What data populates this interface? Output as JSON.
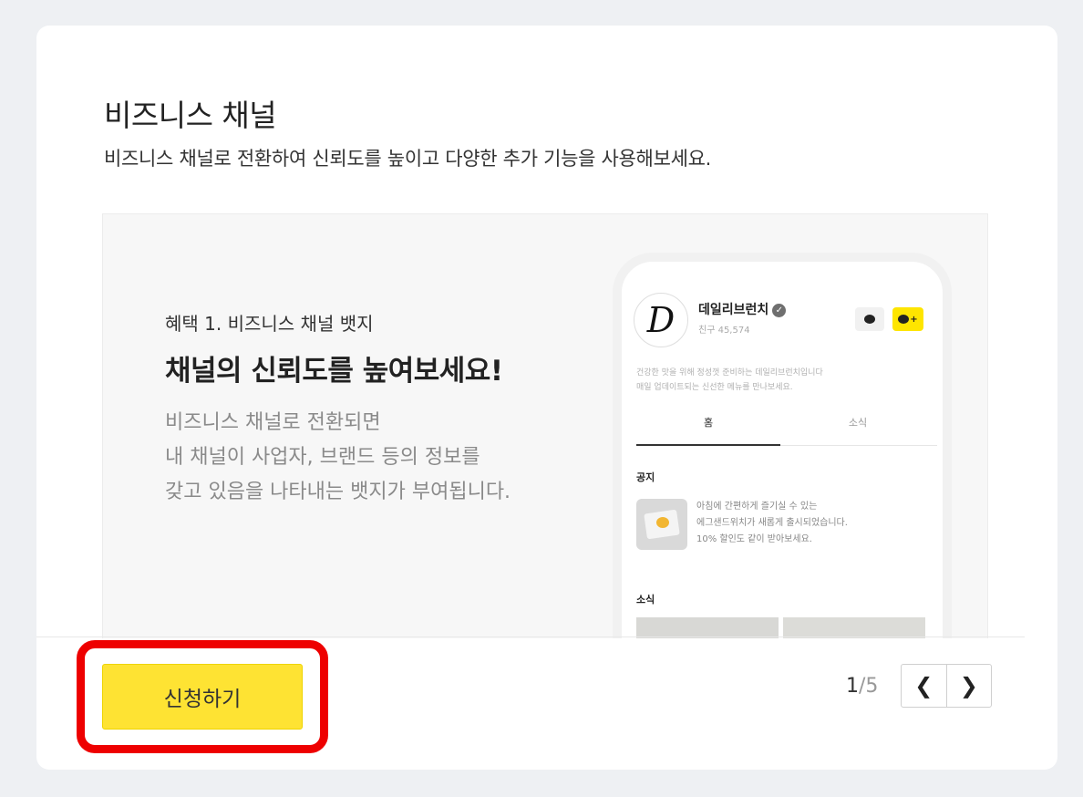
{
  "section": {
    "title": "비즈니스 채널",
    "subtitle": "비즈니스 채널로 전환하여 신뢰도를 높이고 다양한 추가 기능을 사용해보세요."
  },
  "slide": {
    "benefit_label": "혜택 1. 비즈니스 채널 뱃지",
    "headline": "채널의 신뢰도를 높여보세요!",
    "description": [
      "비즈니스 채널로 전환되면",
      "내 채널이 사업자, 브랜드 등의 정보를",
      "갖고 있음을 나타내는 뱃지가 부여됩니다."
    ]
  },
  "phone": {
    "logo_letter": "D",
    "channel_name": "데일리브런치",
    "verified_mark": "✓",
    "friends": "친구 45,574",
    "chat_icon": "chat-bubble-icon",
    "add_friend_icon": "add-friend-icon",
    "add_friend_plus": "+",
    "description": [
      "건강한 맛을 위해 정성껏 준비하는 데일리브런치입니다",
      "매일 업데이트되는 신선한 메뉴를 만나보세요."
    ],
    "tabs": [
      "홈",
      "소식"
    ],
    "notice_label": "공지",
    "notice_lines": [
      "아침에 간편하게 즐기실 수 있는",
      "에그샌드위치가 새롭게 출시되었습니다.",
      "10% 할인도 같이 받아보세요."
    ],
    "news_label": "소식"
  },
  "actions": {
    "apply_label": "신청하기"
  },
  "pagination": {
    "current": "1",
    "separator": "/",
    "total": "5",
    "prev_icon": "chevron-left-icon",
    "next_icon": "chevron-right-icon",
    "prev_glyph": "❮",
    "next_glyph": "❯"
  },
  "colors": {
    "accent_yellow": "#fee333",
    "highlight_red": "#ee0000"
  }
}
